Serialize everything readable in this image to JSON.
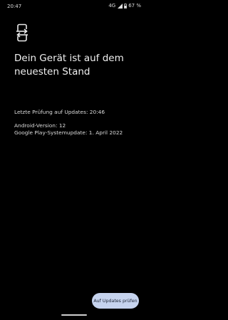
{
  "status_bar": {
    "time": "20:47",
    "network": "4G",
    "battery": "67 %"
  },
  "icons": {
    "update": "system-update-icon",
    "signal": "signal-icon",
    "battery": "battery-icon"
  },
  "main": {
    "headline": "Dein Gerät ist auf dem neuesten Stand",
    "last_check": "Letzte Prüfung auf Updates: 20:46",
    "android_version": "Android-Version: 12",
    "play_system_update": "Google Play-Systemupdate: 1. April 2022"
  },
  "actions": {
    "check_updates_label": "Auf Updates prüfen"
  },
  "colors": {
    "background": "#000000",
    "text": "#e8e8e8",
    "button_bg": "#c6d3ee",
    "button_text": "#1b2333"
  }
}
